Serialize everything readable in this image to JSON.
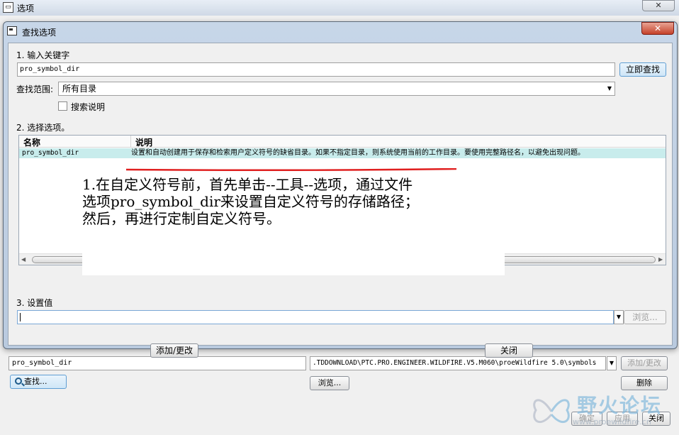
{
  "background_window": {
    "title": "选项",
    "close_symbol": "✕",
    "option_value": "pro_symbol_dir",
    "value_path": ".TDDOWNLOAD\\PTC.PRO.ENGINEER.WILDFIRE.V5.M060\\proeWildfire 5.0\\symbols",
    "add_change_label": "添加/更改",
    "find_label": "查找...",
    "browse_label": "浏览...",
    "delete_label": "删除",
    "ok_label": "确定",
    "apply_label": "应用",
    "close_label": "关闭"
  },
  "dialog": {
    "title": "查找选项",
    "close_symbol": "✕",
    "section1_label": "1.   输入关键字",
    "keyword_value": "pro_symbol_dir",
    "search_now_label": "立即查找",
    "scope_label": "查找范围:",
    "scope_value": "所有目录",
    "search_desc_label": "搜索说明",
    "section2_label": "2.   选择选项。",
    "table": {
      "columns": [
        "名称",
        "说明"
      ],
      "rows": [
        {
          "name": "pro_symbol_dir",
          "description": "设置和自动创建用于保存和检索用户定义符号的缺省目录。如果不指定目录，则系统使用当前的工作目录。要使用完整路径名，以避免出现问题。"
        }
      ]
    },
    "section3_label": "3.   设置值",
    "browse_label": "浏览...",
    "add_change_label": "添加/更改",
    "close_label": "关闭"
  },
  "annotation": {
    "lines": [
      "1.在自定义符号前，首先单击--工具--选项，通过文件",
      "选项pro_symbol_dir来设置自定义符号的存储路径；",
      "然后，再进行定制自定义符号。"
    ],
    "underline_color": "#e02020"
  },
  "watermark": {
    "text": "野火论坛",
    "url": "www.proewildfire.cn"
  },
  "colors": {
    "dialog_frame": "#c7d6e8",
    "selected_row": "#c8ecec",
    "close_button": "#c5422a"
  }
}
